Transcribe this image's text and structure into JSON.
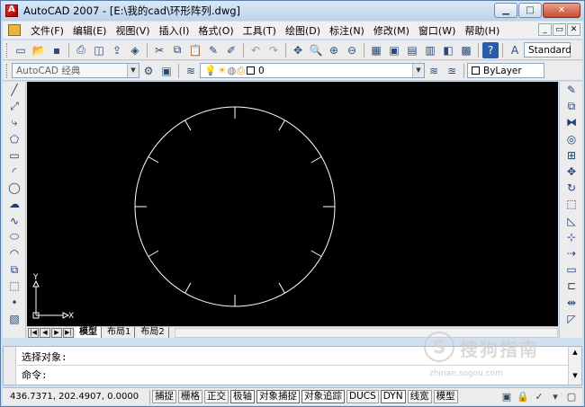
{
  "window": {
    "title": "AutoCAD 2007 - [E:\\我的cad\\环形阵列.dwg]",
    "controls": {
      "minimize": "▁",
      "maximize": "□",
      "close": "✕"
    }
  },
  "menubar": {
    "items": [
      "文件(F)",
      "编辑(E)",
      "视图(V)",
      "插入(I)",
      "格式(O)",
      "工具(T)",
      "绘图(D)",
      "标注(N)",
      "修改(M)",
      "窗口(W)",
      "帮助(H)"
    ],
    "mdi_controls": [
      "_",
      "▭",
      "✕"
    ]
  },
  "toolbar1": {
    "text_style": "Standard"
  },
  "toolbar2": {
    "workspace": "AutoCAD 经典",
    "layer": "0",
    "color": "ByLayer"
  },
  "canvas": {
    "ucs_x_label": "X",
    "ucs_y_label": "Y"
  },
  "tabs": {
    "nav": [
      "|◀",
      "◀",
      "▶",
      "▶|"
    ],
    "items": [
      "模型",
      "布局1",
      "布局2"
    ]
  },
  "command": {
    "line1": "选择对象:",
    "line2": "命令:"
  },
  "watermark": {
    "text": "搜狗指南",
    "sub": "zhinan.sogou.com"
  },
  "status": {
    "coordinates": "436.7371, 202.4907, 0.0000",
    "buttons": [
      "捕捉",
      "栅格",
      "正交",
      "极轴",
      "对象捕捉",
      "对象追踪",
      "DUCS",
      "DYN",
      "线宽",
      "模型"
    ]
  }
}
